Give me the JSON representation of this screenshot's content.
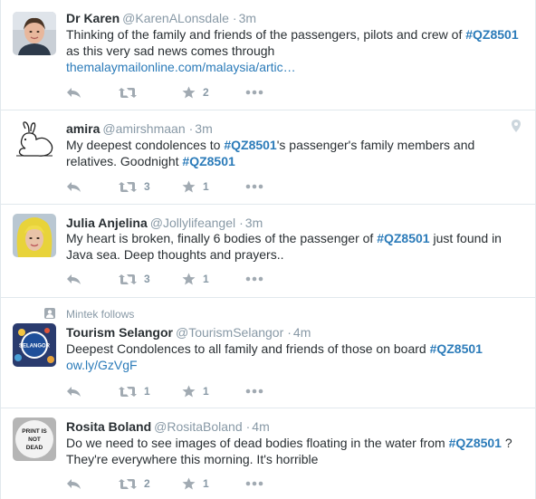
{
  "tweets": [
    {
      "fullname": "Dr Karen",
      "handle": "@KarenALonsdale",
      "time": "3m",
      "text_parts": [
        {
          "t": "Thinking of the family and friends of the passengers, pilots and crew of "
        },
        {
          "t": "#QZ8501",
          "k": "hashtag"
        },
        {
          "t": " as this very sad news comes through"
        }
      ],
      "link": "themalaymailonline.com/malaysia/artic…",
      "retweets": "",
      "favorites": "2",
      "avatar": "photo-woman"
    },
    {
      "fullname": "amira",
      "handle": "@amirshmaan",
      "time": "3m",
      "text_parts": [
        {
          "t": "My deepest condolences to "
        },
        {
          "t": "#QZ8501",
          "k": "hashtag"
        },
        {
          "t": "'s passenger's family members and relatives. Goodnight "
        },
        {
          "t": "#QZ8501",
          "k": "hashtag"
        }
      ],
      "retweets": "3",
      "favorites": "1",
      "avatar": "rabbit-drawing"
    },
    {
      "fullname": "Julia Anjelina",
      "handle": "@Jollylifeangel",
      "time": "3m",
      "text_parts": [
        {
          "t": "My heart is broken, finally 6 bodies of the passenger of "
        },
        {
          "t": "#QZ8501",
          "k": "hashtag"
        },
        {
          "t": " just found in Java sea. Deep thoughts and prayers.."
        }
      ],
      "retweets": "3",
      "favorites": "1",
      "avatar": "photo-yellow-hair"
    },
    {
      "context": "Mintek follows",
      "fullname": "Tourism Selangor",
      "handle": "@TourismSelangor",
      "time": "4m",
      "text_parts": [
        {
          "t": "Deepest Condolences  to all family and friends of those on board "
        },
        {
          "t": "#QZ8501",
          "k": "hashtag"
        }
      ],
      "link": "ow.ly/GzVgF",
      "retweets": "1",
      "favorites": "1",
      "avatar": "selangor-logo",
      "avatar_text": "SELANGOR"
    },
    {
      "fullname": "Rosita Boland",
      "handle": "@RositaBoland",
      "time": "4m",
      "text_parts": [
        {
          "t": "Do we need to see images of dead bodies floating in the water from "
        },
        {
          "t": "#QZ8501",
          "k": "hashtag"
        },
        {
          "t": " ? They're everywhere this morning. It's horrible"
        }
      ],
      "retweets": "2",
      "favorites": "1",
      "avatar": "print-is-not-dead",
      "avatar_text": [
        "PRINT IS",
        "NOT",
        "DEAD"
      ]
    }
  ],
  "colors": {
    "hashtag": "#2b7bb9",
    "muted": "#8899a6",
    "icon": "#a1aab2",
    "divider": "#e1e8ed"
  }
}
